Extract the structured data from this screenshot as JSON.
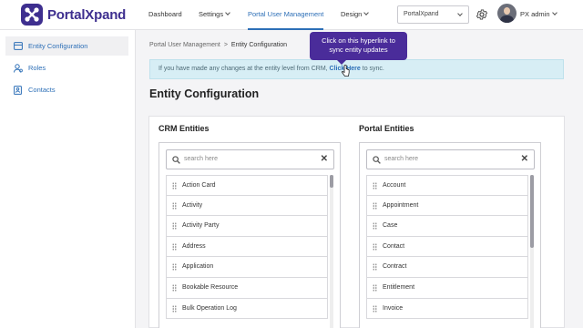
{
  "app": {
    "name": "PortalXpand"
  },
  "nav": {
    "dashboard": "Dashboard",
    "settings": "Settings",
    "portal_user_management": "Portal User Management",
    "design": "Design"
  },
  "portal_select": {
    "value": "PortalXpand"
  },
  "user": {
    "name": "PX admin"
  },
  "sidebar": {
    "items": [
      {
        "label": "Entity Configuration",
        "icon": "entity-icon"
      },
      {
        "label": "Roles",
        "icon": "roles-icon"
      },
      {
        "label": "Contacts",
        "icon": "contacts-icon"
      }
    ]
  },
  "breadcrumb": {
    "parent": "Portal User Management",
    "separator": ">",
    "current": "Entity Configuration"
  },
  "info": {
    "text_before": "If you have made any changes at the entity level from CRM,",
    "link": "Click Here",
    "text_after": "to sync."
  },
  "tooltip": {
    "line1": "Click on this hyperlink to",
    "line2": "sync entity updates"
  },
  "page_title": "Entity Configuration",
  "crm": {
    "title": "CRM Entities",
    "search_placeholder": "search here",
    "items": [
      "Action Card",
      "Activity",
      "Activity Party",
      "Address",
      "Application",
      "Bookable Resource",
      "Bulk Operation Log"
    ]
  },
  "portal": {
    "title": "Portal Entities",
    "search_placeholder": "search here",
    "items": [
      "Account",
      "Appointment",
      "Case",
      "Contact",
      "Contract",
      "Entitlement",
      "Invoice"
    ]
  },
  "colors": {
    "brand": "#3e2f8f",
    "accent": "#2d6fb7",
    "tooltip": "#4a2c9a",
    "info_bg": "#d7eef5"
  }
}
